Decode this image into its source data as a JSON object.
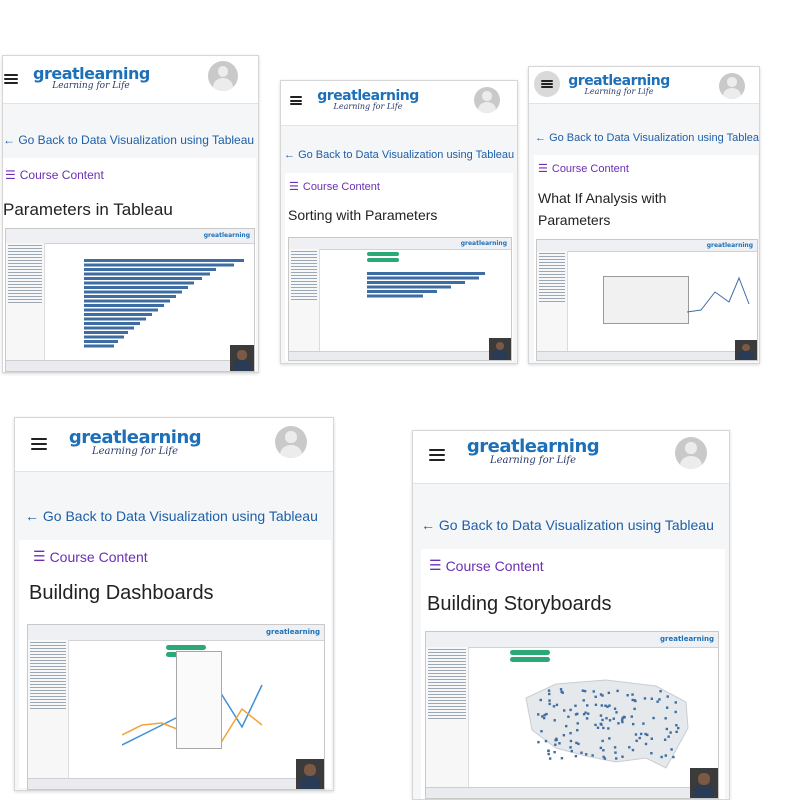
{
  "cards": [
    {
      "brand": "greatlearning",
      "tagline": "Learning for Life",
      "back_link": "Go Back to Data Visualization using Tableau",
      "course_content": "Course Content",
      "lesson_title": "Parameters in Tableau",
      "thumb_brand": "greatlearning"
    },
    {
      "brand": "greatlearning",
      "tagline": "Learning for Life",
      "back_link": "Go Back to Data Visualization using Tableau",
      "course_content": "Course Content",
      "lesson_title": "Sorting with Parameters",
      "thumb_brand": "greatlearning"
    },
    {
      "brand": "greatlearning",
      "tagline": "Learning for Life",
      "back_link": "Go Back to Data Visualization using Tableau",
      "course_content": "Course Content",
      "lesson_title": "What If Analysis with Parameters",
      "thumb_brand": "greatlearning"
    },
    {
      "brand": "greatlearning",
      "tagline": "Learning for Life",
      "back_link": "Go Back to Data Visualization using Tableau",
      "course_content": "Course Content",
      "lesson_title": "Building Dashboards",
      "thumb_brand": "greatlearning"
    },
    {
      "brand": "greatlearning",
      "tagline": "Learning for Life",
      "back_link": "Go Back to Data Visualization using Tableau",
      "course_content": "Course Content",
      "lesson_title": "Building Storyboards",
      "thumb_brand": "greatlearning"
    }
  ],
  "icons": {
    "menu": "hamburger-icon",
    "profile": "user-avatar-icon",
    "back": "left-arrow-icon",
    "list": "list-icon"
  },
  "colors": {
    "brand_blue": "#1d70b8",
    "link_blue": "#1d5fa8",
    "course_purple": "#6b2fb3",
    "chart_bar": "#3e6da3",
    "tableau_pill": "#2aa876"
  }
}
